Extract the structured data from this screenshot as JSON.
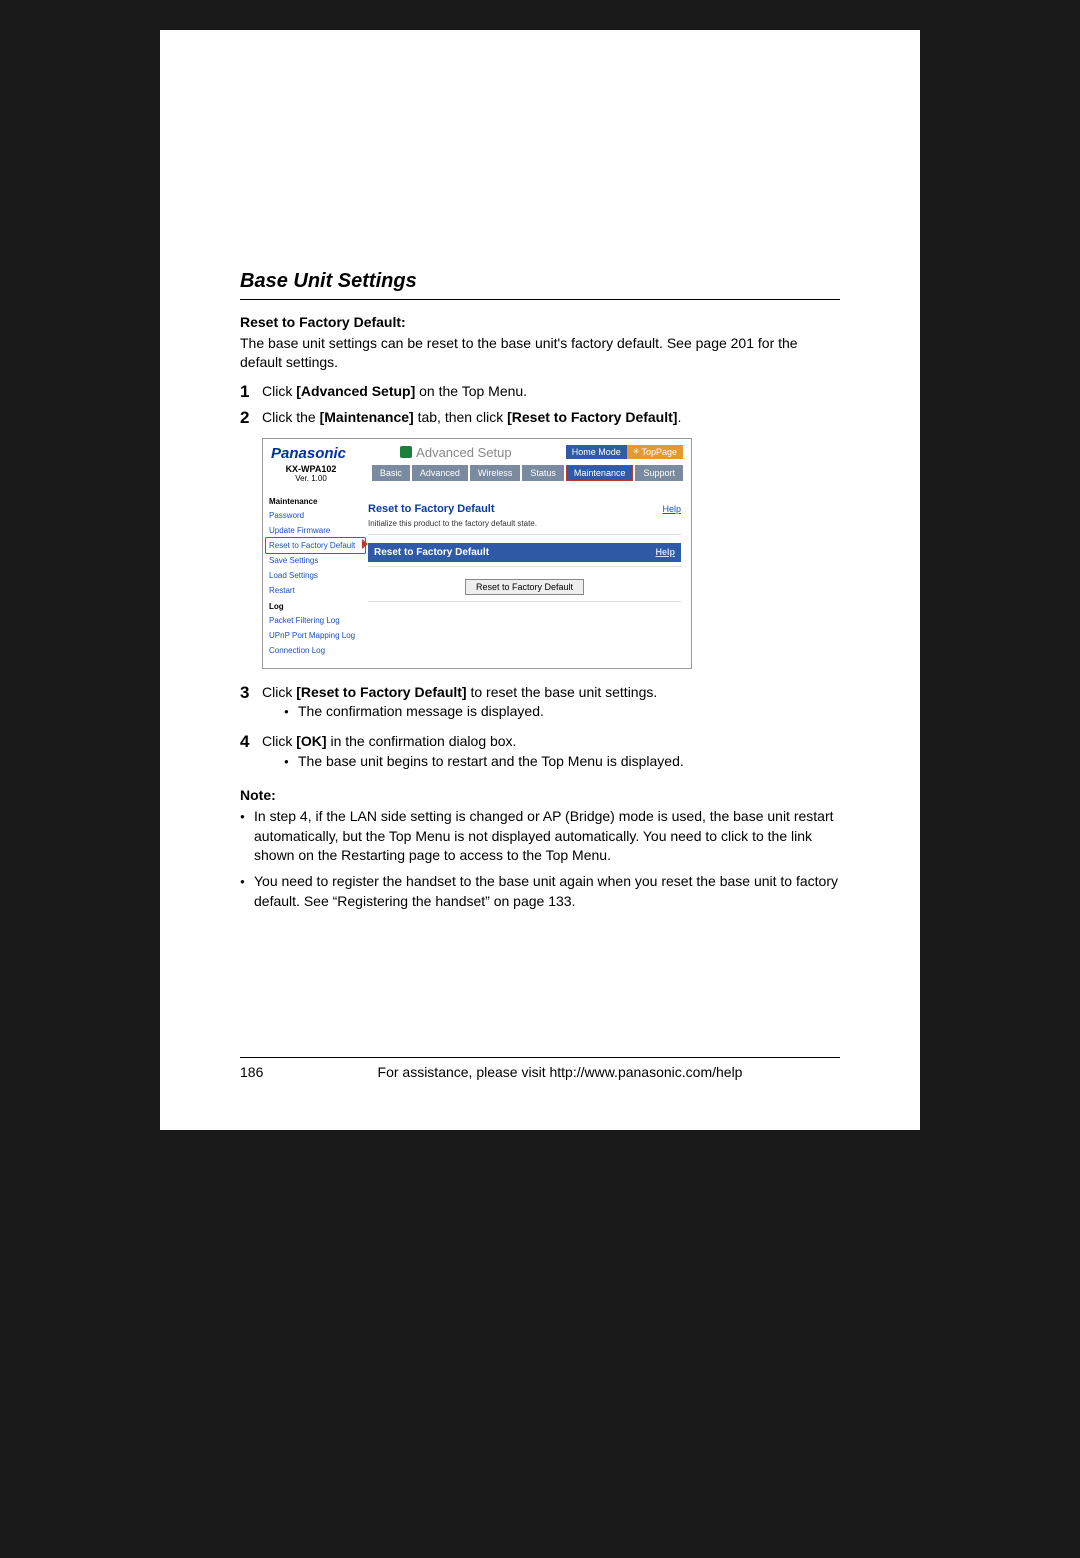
{
  "section_title": "Base Unit Settings",
  "reset_heading": "Reset to Factory Default:",
  "reset_body": "The base unit settings can be reset to the base unit's factory default. See page 201 for the default settings.",
  "step1_pre": "Click ",
  "step1_bold": "[Advanced Setup]",
  "step1_post": " on the Top Menu.",
  "step2_pre": "Click the ",
  "step2_bold1": "[Maintenance]",
  "step2_mid": " tab, then click ",
  "step2_bold2": "[Reset to Factory Default]",
  "step2_post": ".",
  "step3_pre": "Click ",
  "step3_bold": "[Reset to Factory Default]",
  "step3_post": " to reset the base unit settings.",
  "step3_bullet": "The confirmation message is displayed.",
  "step4_pre": "Click ",
  "step4_bold": "[OK]",
  "step4_post": " in the confirmation dialog box.",
  "step4_bullet": "The base unit begins to restart and the Top Menu is displayed.",
  "note_heading": "Note:",
  "note1": "In step 4, if the LAN side setting is changed or AP (Bridge) mode is used, the base unit restart automatically, but the Top Menu is not displayed automatically. You need to click to the link shown on the Restarting page to access to the Top Menu.",
  "note2": "You need to register the handset to the base unit again when you reset the base unit to factory default. See “Registering the handset” on page 133.",
  "page_number": "186",
  "footer_text": "For assistance, please visit http://www.panasonic.com/help",
  "shot": {
    "brand": "Panasonic",
    "title": "Advanced Setup",
    "home_mode": "Home Mode",
    "top_page": "TopPage",
    "model": "KX-WPA102",
    "version": "Ver. 1.00",
    "tabs": {
      "basic": "Basic",
      "advanced": "Advanced",
      "wireless": "Wireless",
      "status": "Status",
      "maintenance": "Maintenance",
      "support": "Support"
    },
    "side": {
      "group_maintenance": "Maintenance",
      "password": "Password",
      "update_firmware": "Update Firmware",
      "reset_factory": "Reset to Factory Default",
      "save_settings": "Save Settings",
      "load_settings": "Load Settings",
      "restart": "Restart",
      "group_log": "Log",
      "packet_filtering_log": "Packet Filtering Log",
      "upnp_log": "UPnP Port Mapping Log",
      "connection_log": "Connection Log"
    },
    "card": {
      "title": "Reset to Factory Default",
      "help": "Help",
      "desc": "Initialize this product to the factory default state.",
      "bar_title": "Reset to Factory Default",
      "button": "Reset to Factory Default"
    }
  }
}
